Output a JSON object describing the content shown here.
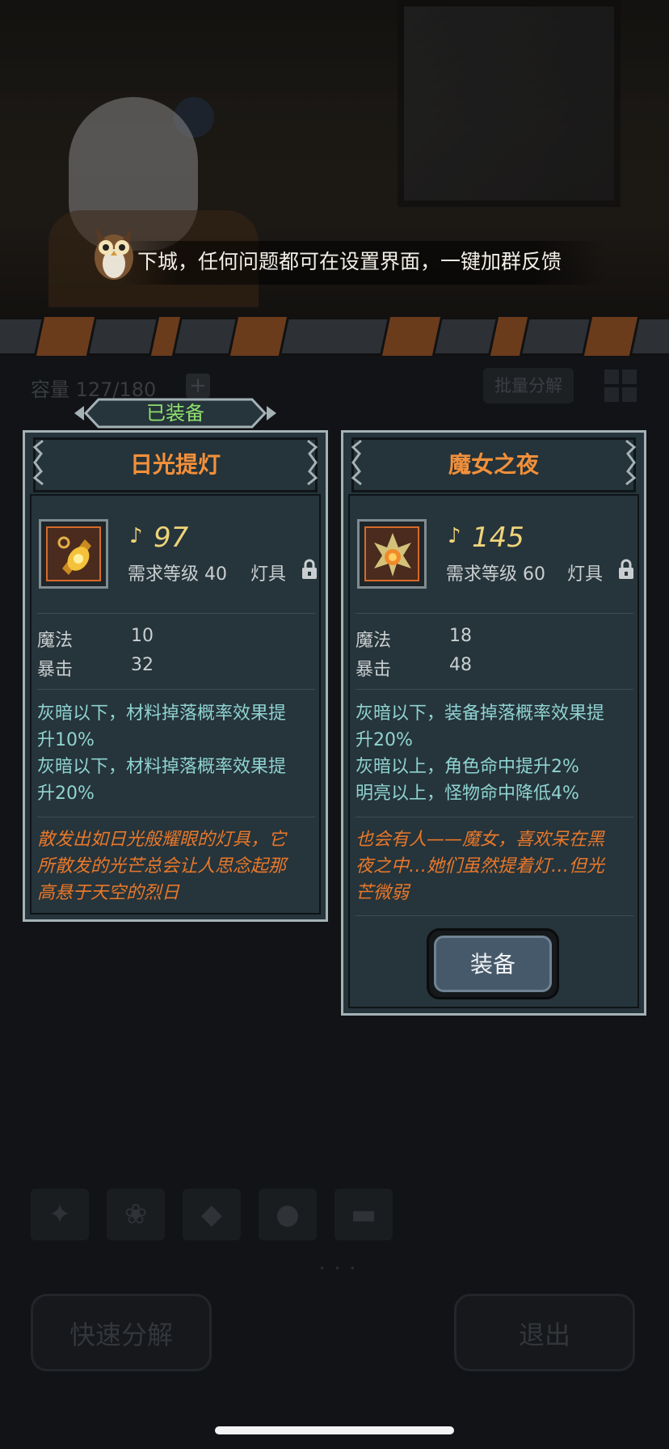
{
  "announcement": {
    "text": "下城，任何问题都可在设置界面，一键加群反馈"
  },
  "inventory": {
    "capacity_label": "容量 127/180",
    "add_symbol": "+",
    "batch_label": "批量分解"
  },
  "equipped_tag": "已装备",
  "cards": [
    {
      "name": "日光提灯",
      "power": "97",
      "requirement": "需求等级 40",
      "category": "灯具",
      "stats": [
        {
          "name": "魔法",
          "value": "10"
        },
        {
          "name": "暴击",
          "value": "32"
        }
      ],
      "effects": [
        "灰暗以下，材料掉落概率效果提",
        "升10%",
        "灰暗以下，材料掉落概率效果提",
        "升20%"
      ],
      "lore": [
        "散发出如日光般耀眼的灯具，它",
        "所散发的光芒总会让人思念起那",
        "高悬于天空的烈日"
      ]
    },
    {
      "name": "魔女之夜",
      "power": "145",
      "requirement": "需求等级 60",
      "category": "灯具",
      "stats": [
        {
          "name": "魔法",
          "value": "18"
        },
        {
          "name": "暴击",
          "value": "48"
        }
      ],
      "effects": [
        "灰暗以下，装备掉落概率效果提",
        "升20%",
        "灰暗以上，角色命中提升2%",
        "明亮以上，怪物命中降低4%"
      ],
      "lore": [
        "也会有人——魔女，喜欢呆在黑",
        "夜之中…她们虽然提着灯…但光",
        "芒微弱"
      ],
      "equip_button": "装备"
    }
  ],
  "bottom": {
    "quick_decompose": "快速分解",
    "exit": "退出"
  },
  "colors": {
    "accent": "#f2903a",
    "effect": "#8fd3d1",
    "lore": "#e8782a",
    "power": "#efd37a",
    "equipped": "#8fe06d"
  }
}
